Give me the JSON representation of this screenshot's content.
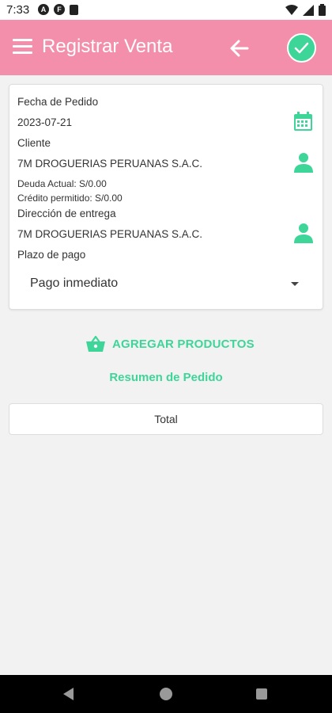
{
  "status_bar": {
    "time": "7:33",
    "icon_a": "A",
    "icon_f": "F"
  },
  "app_bar": {
    "title": "Registrar Venta"
  },
  "form": {
    "fecha_label": "Fecha de Pedido",
    "fecha_value": "2023-07-21",
    "cliente_label": "Cliente",
    "cliente_value": "7M DROGUERIAS PERUANAS S.A.C.",
    "deuda_actual": "Deuda Actual: S/0.00",
    "credito_permitido": "Crédito permitido: S/0.00",
    "direccion_label": "Dirección de entrega",
    "direccion_value": "7M DROGUERIAS PERUANAS S.A.C.",
    "plazo_label": "Plazo de pago",
    "plazo_value": "Pago inmediato"
  },
  "actions": {
    "agregar_label": "AGREGAR PRODUCTOS",
    "resumen_label": "Resumen de Pedido",
    "total_label": "Total"
  },
  "colors": {
    "appbar": "#f48fab",
    "accent": "#3dd598"
  },
  "icons": [
    "menu-icon",
    "back-arrow-icon",
    "check-icon",
    "calendar-icon",
    "person-icon",
    "basket-icon"
  ]
}
